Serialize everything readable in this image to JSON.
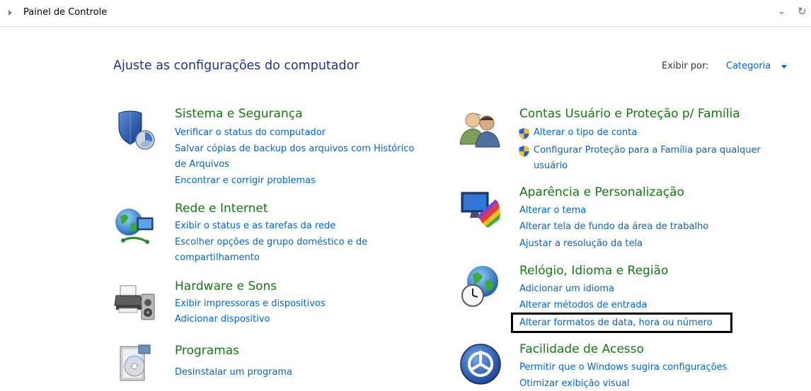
{
  "address": {
    "path": "Painel de Controle"
  },
  "header": {
    "title": "Ajuste as configurações do computador",
    "view_by_label": "Exibir por:",
    "view_by_value": "Categoria"
  },
  "categories": {
    "system": {
      "title": "Sistema e Segurança",
      "icon": "shield-computer-icon",
      "links": [
        "Verificar o status do computador",
        "Salvar cópias de backup dos arquivos com Histórico",
        "de Arquivos",
        "Encontrar e corrigir problemas"
      ]
    },
    "network": {
      "title": "Rede e Internet",
      "icon": "globe-network-icon",
      "links": [
        "Exibir o status e as tarefas da rede",
        "Escolher opções de grupo doméstico e de",
        "compartilhamento"
      ]
    },
    "hardware": {
      "title": "Hardware e Sons",
      "icon": "printer-speaker-icon",
      "links": [
        "Exibir impressoras e dispositivos",
        "Adicionar dispositivo"
      ]
    },
    "programs": {
      "title": "Programas",
      "icon": "programs-disc-icon",
      "links": [
        "Desinstalar um programa"
      ]
    },
    "accounts": {
      "title": "Contas Usuário e Proteção p/ Família",
      "icon": "users-icon",
      "links": [
        "Alterar o tipo de conta",
        "Configurar Proteção para a Família para qualquer",
        "usuário"
      ]
    },
    "appearance": {
      "title": "Aparência e Personalização",
      "icon": "monitor-palette-icon",
      "links": [
        "Alterar o tema",
        "Alterar tela de fundo da área de trabalho",
        "Ajustar a resolução da tela"
      ]
    },
    "clock": {
      "title": "Relógio, Idioma e Região",
      "icon": "globe-clock-icon",
      "links": [
        "Adicionar um idioma",
        "Alterar métodos de entrada",
        "Alterar formatos de data, hora ou número"
      ]
    },
    "ease": {
      "title": "Facilidade de Acesso",
      "icon": "ease-of-access-icon",
      "links": [
        "Permitir que o Windows sugira configurações",
        "Otimizar exibição visual"
      ]
    }
  },
  "colors": {
    "link": "#0066cc",
    "category_title": "#137a13",
    "page_title": "#1e3287",
    "highlight": "#000000"
  }
}
